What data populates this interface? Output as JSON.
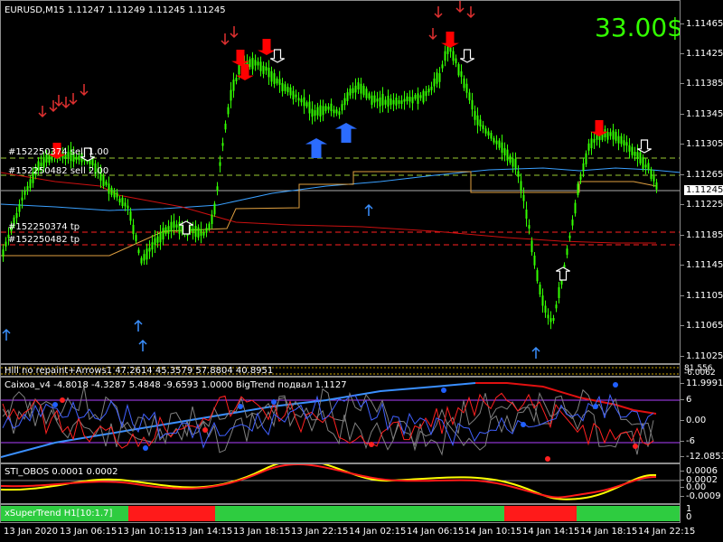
{
  "header": {
    "symbol_line": "EURUSD,M15  1.11247 1.11249 1.11245 1.11245",
    "profit": "33.00$"
  },
  "price_scale": [
    "1.11465",
    "1.11425",
    "1.11385",
    "1.11345",
    "1.11305",
    "1.11265",
    "1.11225",
    "1.11185",
    "1.11145",
    "1.11105",
    "1.11065",
    "1.11025"
  ],
  "current_price": "1.11245",
  "order_labels": [
    "#152250374 sell 1.00",
    "#152250482 sell 2.00",
    "#152250374 tp",
    "#152250482 tp"
  ],
  "indicators": {
    "hill": {
      "title": "Hill no repaint+Arrows1 47.2614 45.3579 57.8804 40.8951",
      "scale": [
        "81.556",
        "-6.0062"
      ]
    },
    "caixoa": {
      "title": "Caixoa_v4 -4.8018 -4.3287 5.4848 -9.6593 1.0000  BigTrend подвал 1.1127",
      "scale": [
        "11.9991",
        "6",
        "0.00",
        "-6",
        "-12.0853"
      ]
    },
    "sti": {
      "title": "STI_OBOS 0.0001 0.0002",
      "scale": [
        "0.0006",
        "0.0002",
        "0.00",
        "-0.0009"
      ]
    },
    "supertrend": {
      "title": "xSuperTrend H1[10:1.7]",
      "scale": [
        "1",
        "0"
      ]
    }
  },
  "time_axis": [
    "13 Jan 2020",
    "13 Jan 06:15",
    "13 Jan 10:15",
    "13 Jan 14:15",
    "13 Jan 18:15",
    "13 Jan 22:15",
    "14 Jan 02:15",
    "14 Jan 06:15",
    "14 Jan 10:15",
    "14 Jan 14:15",
    "14 Jan 18:15",
    "14 Jan 22:15"
  ],
  "colors": {
    "background": "#000000",
    "candles": "#33ff00",
    "sell_arrow": "#ff0000",
    "buy_arrow": "#2b6cff",
    "profit_text": "#33ff00",
    "supertrend_up": "#2ecc40",
    "supertrend_down": "#ff1a1a"
  }
}
